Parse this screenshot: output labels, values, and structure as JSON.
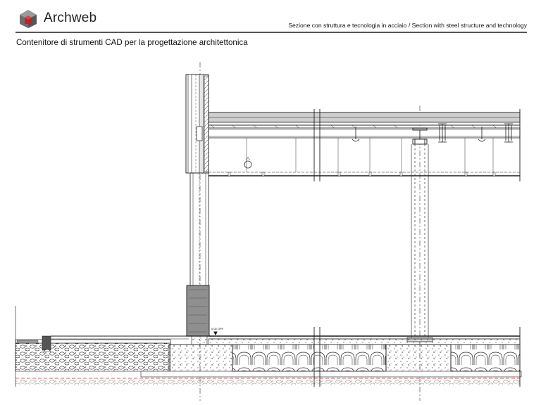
{
  "header": {
    "brand": "Archweb",
    "subtitle": "Sezione con struttura e tecnologia in acciaio  /  Section with steel structure and technology"
  },
  "caption": "Contenitore di strumenti CAD per la progettazione architettonica",
  "drawing": {
    "level_label": "0.00 OPF"
  },
  "colors": {
    "logo_red": "#c0202a",
    "logo_grey": "#6e6e6e",
    "line": "#1a1a1a",
    "dash_red": "#d23030"
  },
  "icons": [
    "archweb-logo-icon"
  ]
}
